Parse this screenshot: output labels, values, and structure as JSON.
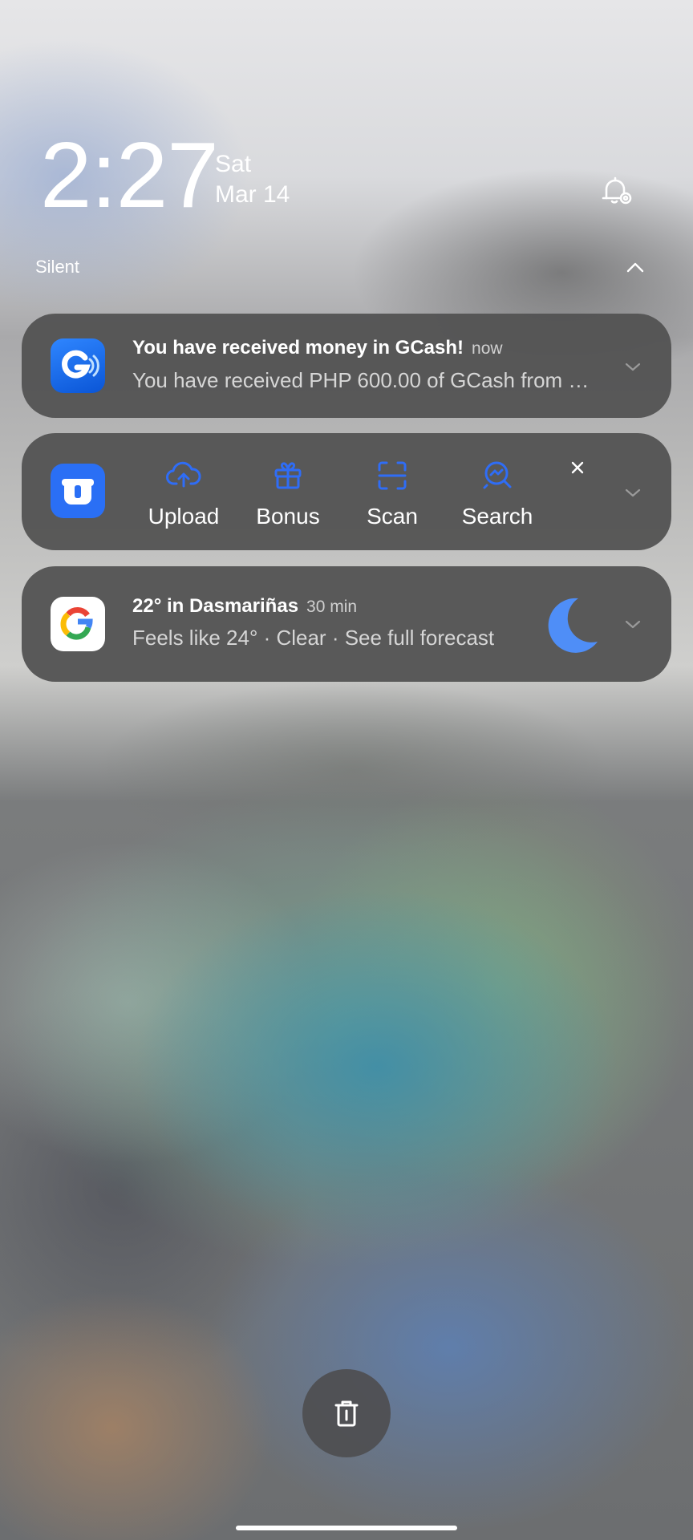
{
  "lockscreen": {
    "time": "2:27",
    "day": "Sat",
    "date": "Mar 14",
    "section_label": "Silent"
  },
  "notifications": [
    {
      "app_icon": "gcash-icon",
      "title": "You have received money in GCash!",
      "time": "now",
      "body": "You have received PHP 600.00 of GCash from …"
    },
    {
      "app_icon": "terabox-icon",
      "actions": [
        {
          "icon": "upload-cloud-icon",
          "label": "Upload"
        },
        {
          "icon": "gift-icon",
          "label": "Bonus"
        },
        {
          "icon": "scan-icon",
          "label": "Scan"
        },
        {
          "icon": "search-icon",
          "label": "Search"
        }
      ]
    },
    {
      "app_icon": "google-icon",
      "title": "22° in Dasmariñas",
      "time": "30 min",
      "body": "Feels like 24° · Clear · See full forecast",
      "weather_icon": "moon-icon"
    }
  ],
  "colors": {
    "accent_blue": "#2f6df6",
    "card_bg": "#525252"
  }
}
